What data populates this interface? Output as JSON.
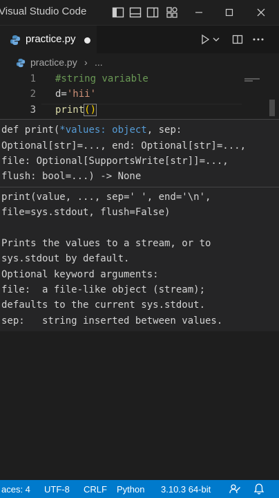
{
  "titlebar": {
    "title": "Visual Studio Code"
  },
  "tab": {
    "label": "practice.py",
    "dirty": true
  },
  "breadcrumb": {
    "file": "practice.py",
    "separator": "›",
    "more": "..."
  },
  "editor": {
    "lines": [
      {
        "number": "1",
        "text": "#string variable"
      },
      {
        "number": "2",
        "text_ident": "d=",
        "text_string": "'hii'"
      },
      {
        "number": "3",
        "text_func": "print",
        "text_paren": "()"
      }
    ]
  },
  "hover": {
    "signature": {
      "l1_def": "def print(",
      "l1_param": "*values: object",
      "l1_rest": ", sep:",
      "l2": "Optional[str]=..., end: Optional[str]=...,",
      "l3": "file: Optional[SupportsWrite[str]]=...,",
      "l4": "flush: bool=...) -> None"
    },
    "doc": [
      "print(value, ..., sep=' ', end='\\n',",
      "file=sys.stdout, flush=False)",
      "",
      "Prints the values to a stream, or to",
      "sys.stdout by default.",
      "Optional keyword arguments:",
      "file:  a file-like object (stream);",
      "defaults to the current sys.stdout.",
      "sep:   string inserted between values."
    ]
  },
  "statusbar": {
    "spaces": "aces: 4",
    "encoding": "UTF-8",
    "eol": "CRLF",
    "language": "Python",
    "interpreter": "3.10.3 64-bit"
  },
  "colors": {
    "accent": "#007acc",
    "comment": "#6a9955",
    "string": "#ce9178",
    "function": "#dcdcaa",
    "param": "#569cd6"
  }
}
